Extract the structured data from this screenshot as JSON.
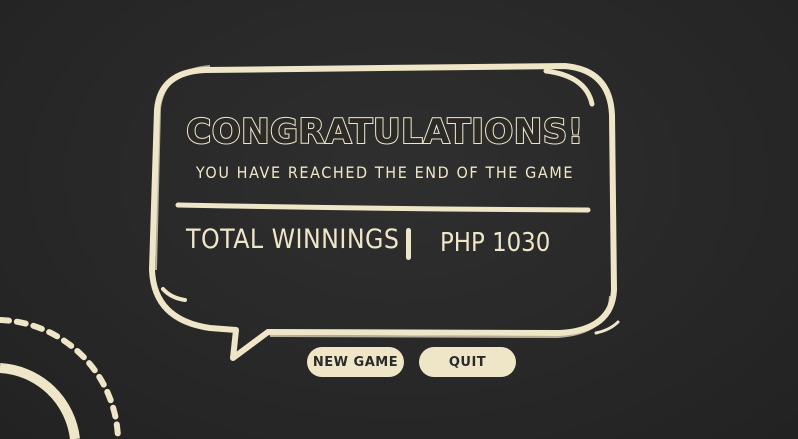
{
  "dialog": {
    "title": "CONGRATULATIONS!",
    "subtitle": "YOU HAVE REACHED THE END OF THE GAME",
    "winnings_label": "TOTAL WINNINGS",
    "winnings_value": "PHP 1030"
  },
  "buttons": {
    "new_game": "NEW GAME",
    "quit": "QUIT"
  },
  "colors": {
    "background": "#262626",
    "cream": "#efe6c8"
  }
}
